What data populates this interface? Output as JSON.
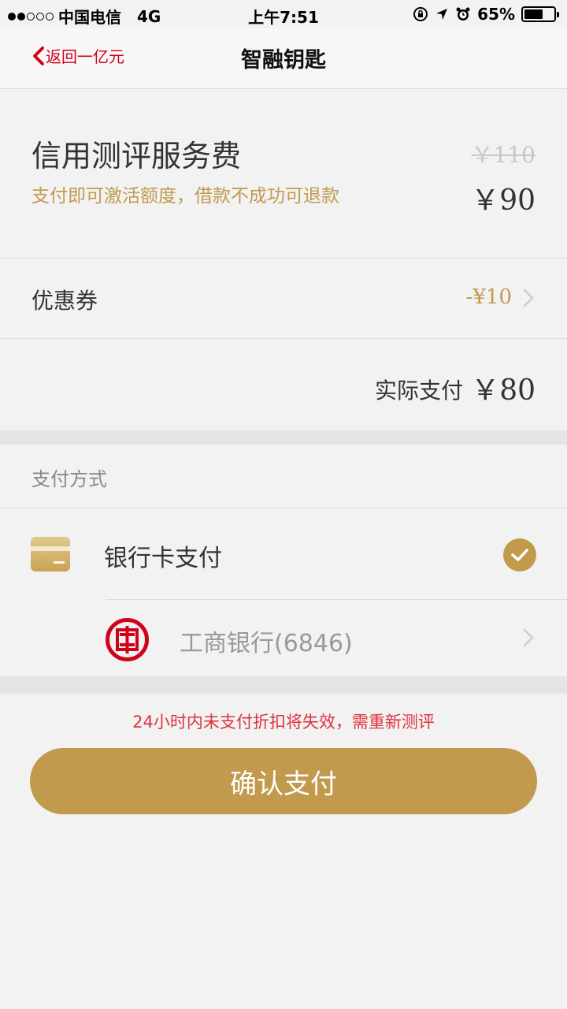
{
  "status_bar": {
    "carrier": "中国电信",
    "network": "4G",
    "time": "上午7:51",
    "battery": "65%",
    "battery_level": 0.65
  },
  "nav": {
    "back_label": "返回一亿元",
    "title": "智融钥匙"
  },
  "fee": {
    "title": "信用测评服务费",
    "subtitle": "支付即可激活额度，借款不成功可退款",
    "original_price": "￥110",
    "price": "￥90"
  },
  "coupon": {
    "label": "优惠券",
    "value": "-¥10"
  },
  "actual": {
    "label": "实际支付",
    "value": "￥80"
  },
  "payment": {
    "section_label": "支付方式",
    "method_label": "银行卡支付",
    "bank_name": "工商银行(6846)"
  },
  "warning": "24小时内未支付折扣将失效，需重新测评",
  "confirm_label": "确认支付",
  "colors": {
    "accent": "#c29a4e",
    "warning": "#e0323c",
    "back": "#d0021b",
    "icbc_red": "#d0021b"
  }
}
